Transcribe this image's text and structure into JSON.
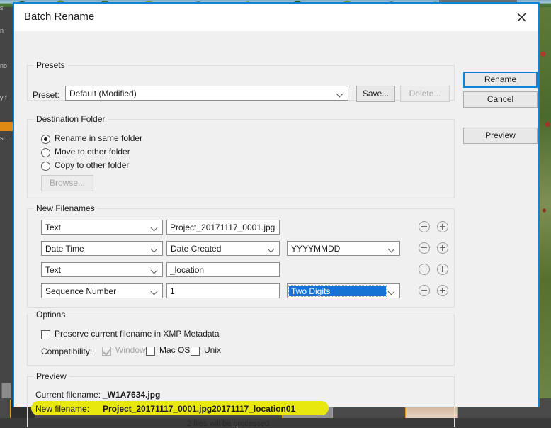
{
  "window": {
    "title": "Batch Rename",
    "close_icon": "close-icon"
  },
  "presets": {
    "group_title": "Presets",
    "preset_label": "Preset:",
    "preset_value": "Default (Modified)",
    "save_label": "Save...",
    "delete_label": "Delete..."
  },
  "destination": {
    "group_title": "Destination Folder",
    "options": [
      {
        "label": "Rename in same folder",
        "checked": true
      },
      {
        "label": "Move to other folder",
        "checked": false
      },
      {
        "label": "Copy to other folder",
        "checked": false
      }
    ],
    "browse_label": "Browse..."
  },
  "new_filenames": {
    "group_title": "New Filenames",
    "rows": [
      {
        "type": "Text",
        "value": "Project_20171117_0001.jpg",
        "option": null,
        "minus": "minus-icon",
        "plus": "plus-icon"
      },
      {
        "type": "Date Time",
        "value": "Date Created",
        "option": "YYYYMMDD",
        "minus": "minus-icon",
        "plus": "plus-icon"
      },
      {
        "type": "Text",
        "value": "_location",
        "option": null,
        "minus": "minus-icon",
        "plus": "plus-icon"
      },
      {
        "type": "Sequence Number",
        "value": "1",
        "option": "Two Digits",
        "minus": "minus-icon",
        "plus": "plus-icon"
      }
    ]
  },
  "options": {
    "group_title": "Options",
    "preserve_label": "Preserve current filename in XMP Metadata",
    "compatibility_label": "Compatibility:",
    "compat": [
      {
        "label": "Windows",
        "checked": true,
        "disabled": true
      },
      {
        "label": "Mac OS",
        "checked": false,
        "disabled": false
      },
      {
        "label": "Unix",
        "checked": false,
        "disabled": false
      }
    ]
  },
  "preview": {
    "group_title": "Preview",
    "current_label": "Current filename:",
    "current_value": "_W1A7634.jpg",
    "new_label": "New filename:",
    "new_value": "Project_20171117_0001.jpg20171117_location01",
    "files_note": "2 files will be processed",
    "highlight_color": "#e8e80f"
  },
  "actions": {
    "rename_label": "Rename",
    "cancel_label": "Cancel",
    "preview_label": "Preview",
    "accent_color": "#0b84d9"
  },
  "background": {
    "sidebar_fragments": [
      "s",
      "n",
      "no",
      "y f",
      "sd"
    ]
  }
}
